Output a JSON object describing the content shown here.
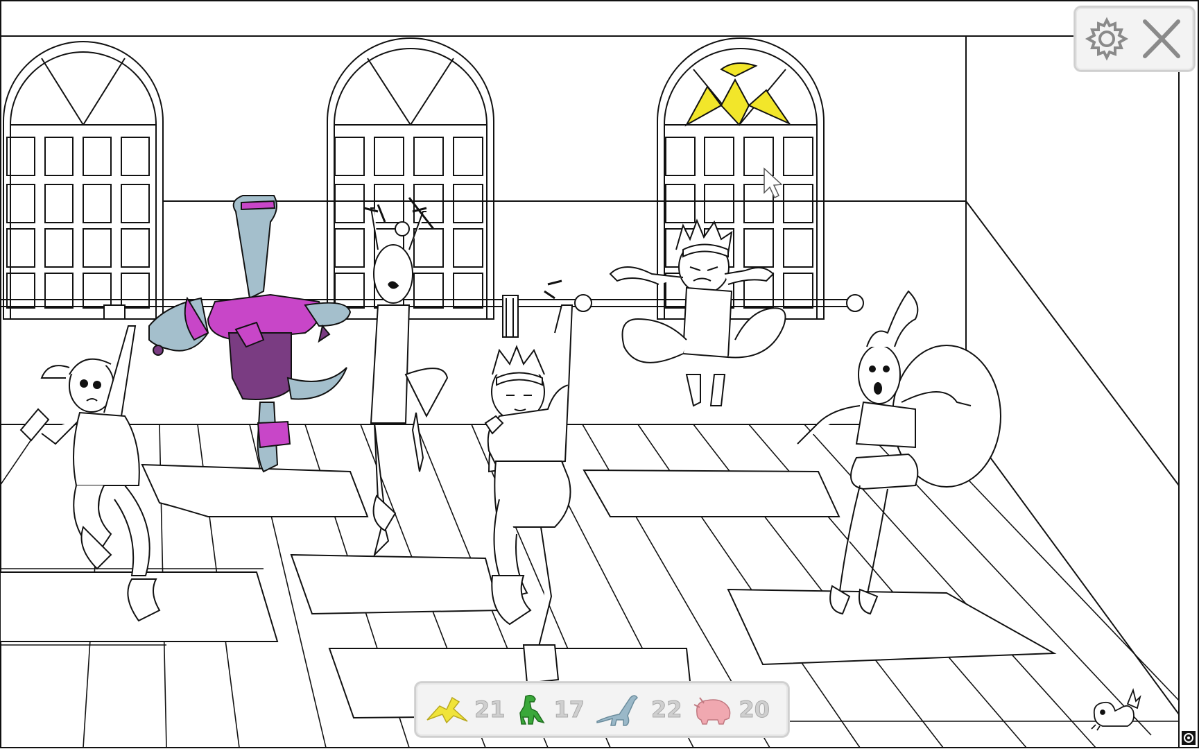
{
  "hud": {
    "settings_icon": "gear-icon",
    "close_icon": "close-icon",
    "corner_icon": "target-icon"
  },
  "counters": [
    {
      "name": "pterodactyl",
      "icon": "pterodactyl-icon",
      "color": "#f0e43a",
      "count": "21"
    },
    {
      "name": "trex",
      "icon": "trex-icon",
      "color": "#3aa83a",
      "count": "17"
    },
    {
      "name": "brachiosaurus",
      "icon": "brachiosaurus-icon",
      "color": "#9ab8c8",
      "count": "22"
    },
    {
      "name": "triceratops",
      "icon": "triceratops-icon",
      "color": "#f0a8b0",
      "count": "20"
    }
  ],
  "colors": {
    "line": "#111111",
    "dino_skin": "#a4bfcc",
    "leotard_pink": "#c846c8",
    "leotard_purple": "#7a3c82",
    "pterodactyl_yellow": "#f2e62a"
  }
}
